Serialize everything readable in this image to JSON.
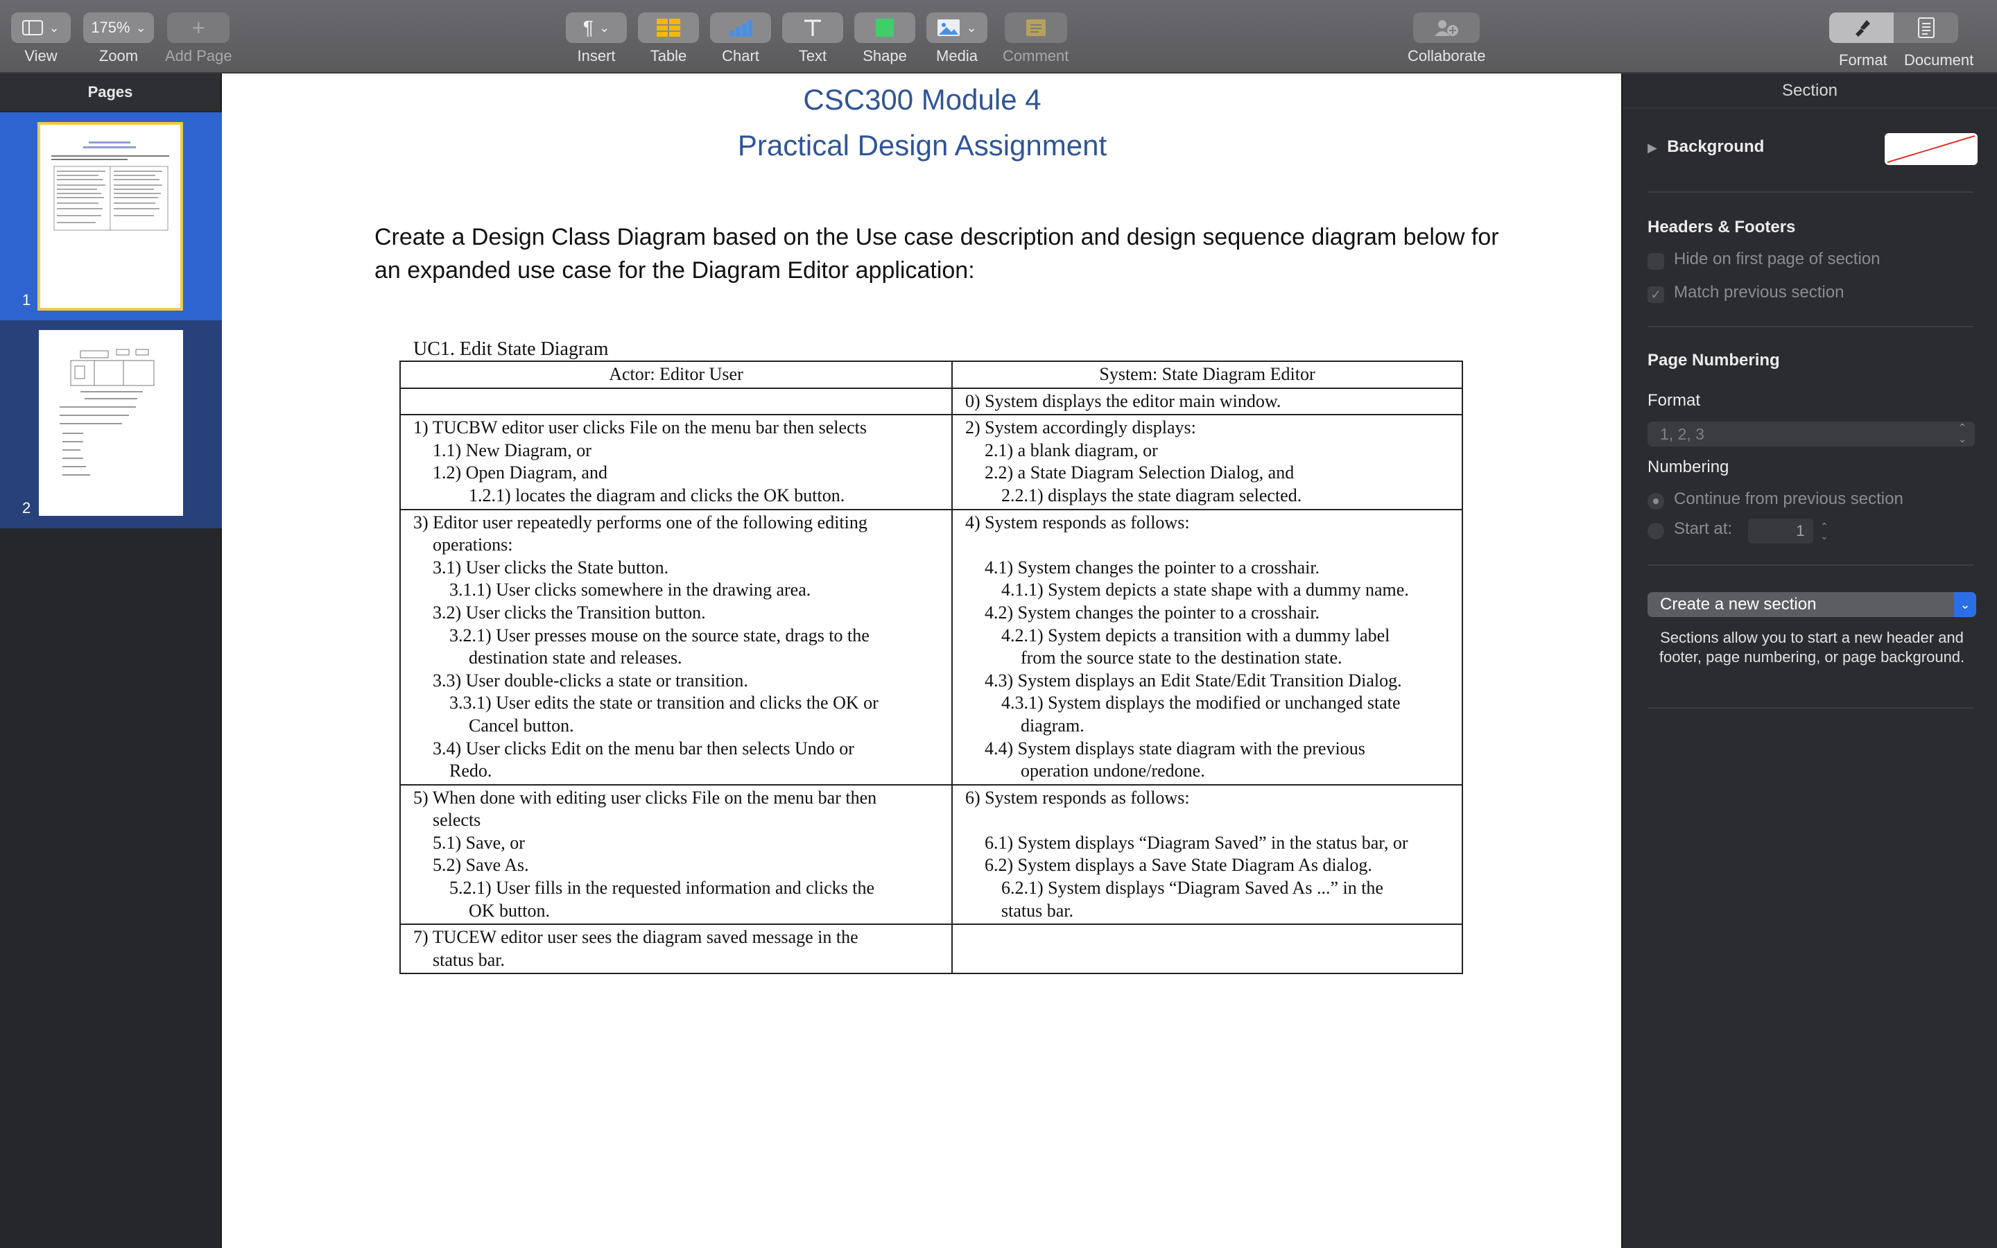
{
  "toolbar": {
    "view": "View",
    "zoom_value": "175%",
    "zoom": "Zoom",
    "add_page": "Add Page",
    "insert": "Insert",
    "table": "Table",
    "chart": "Chart",
    "text": "Text",
    "shape": "Shape",
    "media": "Media",
    "comment": "Comment",
    "collaborate": "Collaborate",
    "format": "Format",
    "document": "Document"
  },
  "sidebar": {
    "title": "Pages",
    "pages": [
      {
        "number": "1",
        "selected": true
      },
      {
        "number": "2",
        "selected": false
      }
    ]
  },
  "doc": {
    "title1": "CSC300 Module 4",
    "title2": "Practical Design Assignment",
    "intro": "Create a Design Class Diagram based on the Use case description and design sequence diagram below for an expanded use case for the Diagram Editor application:",
    "uc_caption": "UC1. Edit State Diagram",
    "headers": {
      "actor": "Actor: Editor User",
      "system": "System: State Diagram Editor"
    },
    "rows": [
      {
        "actor": [],
        "system": [
          "0) System displays the editor main window."
        ]
      },
      {
        "actor": [
          "1) TUCBW editor user clicks File on the menu bar then selects",
          "1.1) New Diagram, or",
          "1.2) Open Diagram, and",
          "1.2.1) locates the diagram and clicks the OK button."
        ],
        "system": [
          "2) System accordingly displays:",
          "2.1) a blank diagram, or",
          "2.2) a State Diagram Selection Dialog, and",
          "2.2.1) displays the state diagram selected."
        ]
      },
      {
        "actor": [
          "3) Editor user repeatedly performs one of the following editing",
          "operations:",
          "3.1) User clicks the State button.",
          "3.1.1) User clicks somewhere in the drawing area.",
          "3.2) User clicks the Transition button.",
          "3.2.1) User presses mouse on the source state, drags to the",
          "destination state and releases.",
          "3.3) User double-clicks a state or transition.",
          "3.3.1) User edits the state or transition and clicks the OK or",
          "Cancel button.",
          "3.4) User clicks Edit on the menu bar then selects Undo or",
          "Redo."
        ],
        "system": [
          "4) System responds as follows:",
          "",
          "4.1) System changes the pointer to a crosshair.",
          "4.1.1) System depicts a state shape with a dummy name.",
          "4.2) System changes the pointer to a crosshair.",
          "4.2.1) System depicts a transition with a dummy label",
          "from the source state to the destination state.",
          "4.3) System displays an Edit State/Edit Transition Dialog.",
          "4.3.1) System displays the modified or unchanged state",
          "diagram.",
          "4.4) System displays state diagram with the previous",
          "operation undone/redone."
        ]
      },
      {
        "actor": [
          "5) When done with editing user clicks File on the menu bar then",
          "selects",
          "5.1) Save, or",
          "5.2) Save As.",
          "5.2.1) User fills in the requested information and clicks the",
          "OK button."
        ],
        "system": [
          "6) System responds as follows:",
          "",
          "6.1) System displays “Diagram Saved” in the status bar, or",
          "6.2) System displays a Save State Diagram As dialog.",
          "6.2.1) System displays “Diagram Saved As ...” in the",
          "status bar."
        ]
      },
      {
        "actor": [
          "7) TUCEW editor user sees the diagram saved message in the",
          "status bar."
        ],
        "system": []
      }
    ]
  },
  "inspector": {
    "title": "Section",
    "background": "Background",
    "headers_footers": "Headers & Footers",
    "hide_first": "Hide on first page of section",
    "match_previous": "Match previous section",
    "page_numbering": "Page Numbering",
    "format_label": "Format",
    "format_value": "1, 2, 3",
    "numbering_label": "Numbering",
    "continue": "Continue from previous section",
    "start_at": "Start at:",
    "start_value": "1",
    "create_section": "Create a new section",
    "note": "Sections allow you to start a new header and footer, page numbering, or page background."
  }
}
